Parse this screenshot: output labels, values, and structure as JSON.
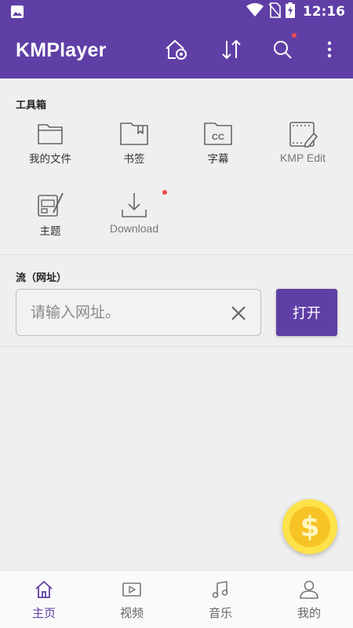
{
  "status_bar": {
    "time": "12:16",
    "icons": [
      "image-icon",
      "wifi-icon",
      "no-sim-icon",
      "battery-charging-icon"
    ]
  },
  "app_bar": {
    "title": "KMPlayer",
    "actions": [
      "home-settings-icon",
      "sort-icon",
      "search-icon",
      "more-vert-icon"
    ],
    "search_has_badge": true
  },
  "tools": {
    "section_title": "工具箱",
    "items": [
      {
        "label": "我的文件",
        "icon": "folder-icon"
      },
      {
        "label": "书签",
        "icon": "bookmark-folder-icon"
      },
      {
        "label": "字幕",
        "icon": "subtitle-cc-icon"
      },
      {
        "label": "KMP Edit",
        "icon": "film-edit-icon"
      },
      {
        "label": "主题",
        "icon": "theme-paint-icon"
      },
      {
        "label": "Download",
        "icon": "download-icon",
        "has_badge": true
      }
    ]
  },
  "stream": {
    "section_title": "流（网址）",
    "url_placeholder": "请输入网址。",
    "url_value": "",
    "open_label": "打开"
  },
  "fab": {
    "symbol": "$",
    "icon": "coin-icon"
  },
  "bottom_nav": {
    "items": [
      {
        "label": "主页",
        "icon": "home-icon",
        "active": true
      },
      {
        "label": "视频",
        "icon": "video-icon",
        "active": false
      },
      {
        "label": "音乐",
        "icon": "music-icon",
        "active": false
      },
      {
        "label": "我的",
        "icon": "person-icon",
        "active": false
      }
    ]
  },
  "colors": {
    "primary": "#5f3fa6",
    "background": "#efefef",
    "badge": "#ef4b4b",
    "coin": "#f7c325"
  }
}
